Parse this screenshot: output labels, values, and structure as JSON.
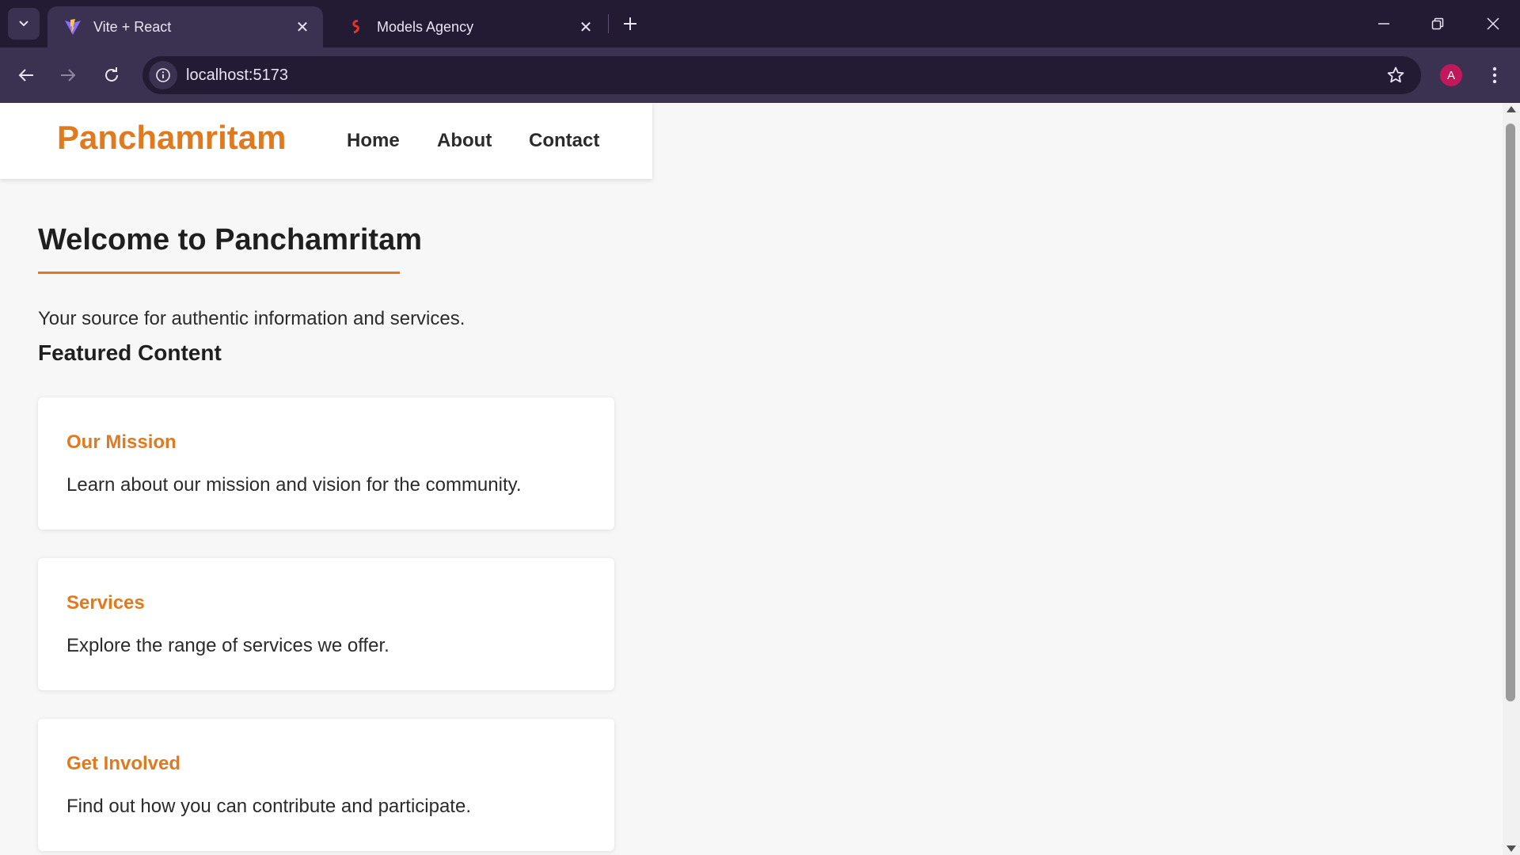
{
  "browser": {
    "tabs": [
      {
        "title": "Vite + React",
        "active": true,
        "favicon": "vite-logo-icon"
      },
      {
        "title": "Models Agency",
        "active": false,
        "favicon": "models-agency-logo-icon"
      }
    ],
    "url": "localhost:5173",
    "profile_initial": "A",
    "colors": {
      "frame": "#231a33",
      "toolbar": "#3b3150",
      "avatar": "#c2185b"
    }
  },
  "site": {
    "brand": "Panchamritam",
    "nav": [
      "Home",
      "About",
      "Contact"
    ],
    "heading": "Welcome to Panchamritam",
    "tagline": "Your source for authentic information and services.",
    "featured_heading": "Featured Content",
    "cards": [
      {
        "title": "Our Mission",
        "text": "Learn about our mission and vision for the community."
      },
      {
        "title": "Services",
        "text": "Explore the range of services we offer."
      },
      {
        "title": "Get Involved",
        "text": "Find out how you can contribute and participate."
      }
    ],
    "colors": {
      "accent": "#e07a1f",
      "text": "#2b2b2b",
      "background": "#f7f7f7"
    }
  }
}
